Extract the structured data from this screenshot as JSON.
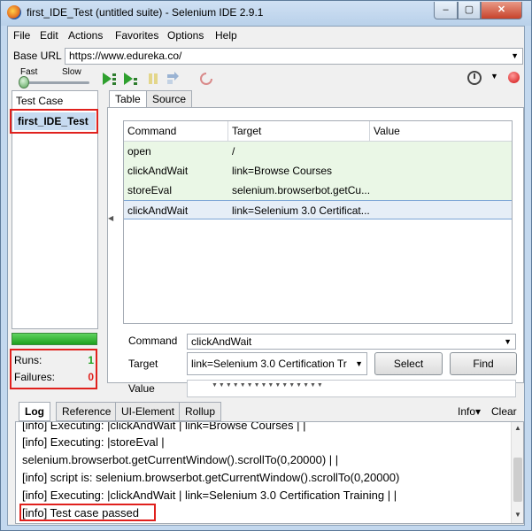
{
  "window": {
    "title": "first_IDE_Test (untitled suite) - Selenium IDE 2.9.1"
  },
  "menu": [
    "File",
    "Edit",
    "Actions",
    "Favorites",
    "Options",
    "Help"
  ],
  "base_url": {
    "label": "Base URL",
    "value": "https://www.edureka.co/"
  },
  "toolbar": {
    "speed_fast": "Fast",
    "speed_slow": "Slow",
    "speed_level": 0.05,
    "icons": [
      "play-suite-icon",
      "play-test-icon",
      "pause-icon",
      "step-icon",
      "rollup-icon",
      "record-icon",
      "clock-icon",
      "stop-record-icon"
    ]
  },
  "test_case_pane": {
    "header": "Test Case",
    "items": [
      "first_IDE_Test"
    ],
    "runs_label": "Runs:",
    "runs_value": "1",
    "failures_label": "Failures:",
    "failures_value": "0",
    "progress": 1.0
  },
  "editor_tabs": [
    "Table",
    "Source"
  ],
  "table": {
    "headers": [
      "Command",
      "Target",
      "Value"
    ],
    "rows": [
      {
        "command": "open",
        "target": "/",
        "value": ""
      },
      {
        "command": "clickAndWait",
        "target": "link=Browse Courses",
        "value": ""
      },
      {
        "command": "storeEval",
        "target": "selenium.browserbot.getCu...",
        "value": ""
      },
      {
        "command": "clickAndWait",
        "target": "link=Selenium 3.0 Certificat...",
        "value": ""
      }
    ]
  },
  "editor": {
    "command_label": "Command",
    "command_value": "clickAndWait",
    "target_label": "Target",
    "target_value": "link=Selenium 3.0 Certification Tr",
    "select_button": "Select",
    "find_button": "Find",
    "value_label": "Value",
    "value_value": ""
  },
  "log_tabs": [
    "Log",
    "Reference",
    "UI-Element",
    "Rollup"
  ],
  "log_actions": {
    "info": "Info▾",
    "clear": "Clear"
  },
  "log_lines": [
    "[info] Executing: |clickAndWait | link=Browse Courses | |",
    "[info] Executing: |storeEval |",
    "selenium.browserbot.getCurrentWindow().scrollTo(0,20000) | |",
    "[info] script is: selenium.browserbot.getCurrentWindow().scrollTo(0,20000)",
    "[info] Executing: |clickAndWait | link=Selenium 3.0 Certification Training | |",
    "[info] Test case passed"
  ],
  "colors": {
    "pass_green": "#1ea11e",
    "failure_red": "#e0211d",
    "row_green": "#eaf7e6",
    "selection_blue": "#c7dbf1"
  }
}
